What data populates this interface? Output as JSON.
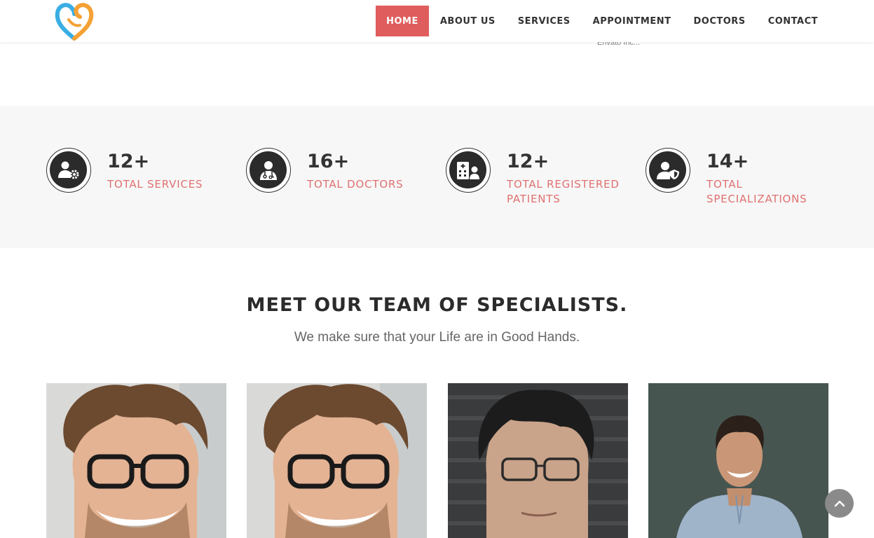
{
  "header": {
    "logo": "heart-logo",
    "nav": [
      {
        "label": "HOME",
        "active": true
      },
      {
        "label": "ABOUT US",
        "active": false
      },
      {
        "label": "SERVICES",
        "active": false
      },
      {
        "label": "APPOINTMENT",
        "active": false
      },
      {
        "label": "DOCTORS",
        "active": false
      },
      {
        "label": "CONTACT",
        "active": false
      }
    ],
    "envato_text": "Envato Inc..."
  },
  "stats": [
    {
      "value": "12+",
      "label": "TOTAL SERVICES",
      "icon": "user-gear-icon"
    },
    {
      "value": "16+",
      "label": "TOTAL DOCTORS",
      "icon": "doctor-icon"
    },
    {
      "value": "12+",
      "label": "TOTAL REGISTERED PATIENTS",
      "icon": "hospital-user-icon"
    },
    {
      "value": "14+",
      "label": "TOTAL SPECIALIZATIONS",
      "icon": "user-shield-icon"
    }
  ],
  "team": {
    "title": "MEET OUR TEAM OF SPECIALISTS.",
    "subtitle": "We make sure that your Life are in Good Hands."
  },
  "doctors": [
    {
      "photo": "smiling-man-glasses-photo"
    },
    {
      "photo": "smiling-man-glasses-photo"
    },
    {
      "photo": "asian-man-glasses-photo"
    },
    {
      "photo": "smiling-man-blue-shirt-photo"
    }
  ],
  "colors": {
    "accent": "#e05d5d",
    "stat_label": "#e07070",
    "dark": "#2b2b2b",
    "band": "#f7f7f7"
  }
}
